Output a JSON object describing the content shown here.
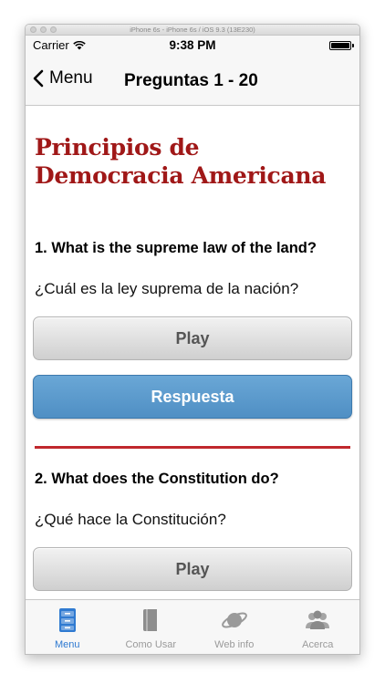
{
  "window": {
    "title": "iPhone 6s - iPhone 6s / iOS 9.3 (13E230)"
  },
  "status": {
    "carrier": "Carrier",
    "time": "9:38 PM"
  },
  "nav": {
    "back_label": "Menu",
    "title": "Preguntas 1 - 20"
  },
  "section": {
    "title": "Principios de Democracia Americana"
  },
  "questions": [
    {
      "en": "1. What is the supreme law of the land?",
      "es": "¿Cuál es la ley suprema de la nación?",
      "play_label": "Play",
      "answer_label": "Respuesta"
    },
    {
      "en": "2. What does the Constitution do?",
      "es": "¿Qué hace la Constitución?",
      "play_label": "Play",
      "answer_label": ""
    }
  ],
  "tabs": [
    {
      "label": "Menu",
      "icon": "cabinet-icon",
      "active": true
    },
    {
      "label": "Como Usar",
      "icon": "book-icon",
      "active": false
    },
    {
      "label": "Web info",
      "icon": "planet-icon",
      "active": false
    },
    {
      "label": "Acerca",
      "icon": "people-icon",
      "active": false
    }
  ],
  "colors": {
    "title_red": "#a01818",
    "divider_red": "#c0282d",
    "answer_blue": "#5b9bcf",
    "tab_active": "#2f7ad1"
  }
}
